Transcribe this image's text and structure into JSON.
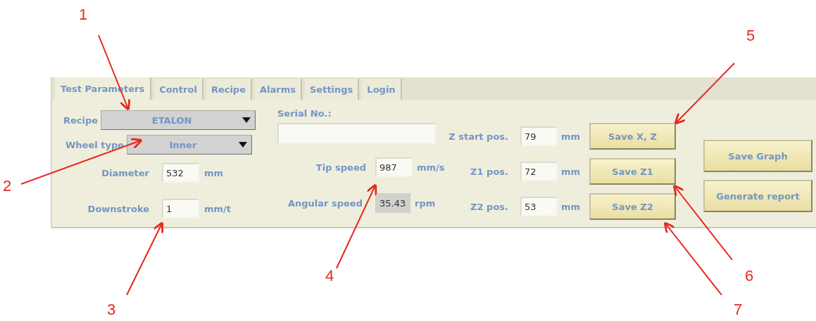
{
  "tabs": [
    {
      "label": "Test Parameters",
      "selected": true
    },
    {
      "label": "Control",
      "selected": false
    },
    {
      "label": "Recipe",
      "selected": false
    },
    {
      "label": "Alarms",
      "selected": false
    },
    {
      "label": "Settings",
      "selected": false
    },
    {
      "label": "Login",
      "selected": false
    }
  ],
  "recipe": {
    "label": "Recipe",
    "value": "ETALON"
  },
  "wheel_type": {
    "label": "Wheel type",
    "value": "Inner"
  },
  "left_fields": [
    {
      "label": "Diameter",
      "value": "532",
      "unit": "mm",
      "readonly": false
    },
    {
      "label": "Downstroke",
      "value": "1",
      "unit": "mm/t",
      "readonly": false
    }
  ],
  "serial": {
    "label": "Serial No.:"
  },
  "mid_fields": [
    {
      "label": "Tip speed",
      "value": "987",
      "unit": "mm/s",
      "readonly": false
    },
    {
      "label": "Angular speed",
      "value": "35.43",
      "unit": "rpm",
      "readonly": true
    }
  ],
  "z_rows": [
    {
      "label": "Z start pos.",
      "value": "79",
      "unit": "mm",
      "button": "Save X, Z"
    },
    {
      "label": "Z1 pos.",
      "value": "72",
      "unit": "mm",
      "button": "Save Z1"
    },
    {
      "label": "Z2 pos.",
      "value": "53",
      "unit": "mm",
      "button": "Save Z2"
    }
  ],
  "side_buttons": [
    "Save Graph",
    "Generate report"
  ],
  "callouts": [
    {
      "label": "1"
    },
    {
      "label": "2"
    },
    {
      "label": "3"
    },
    {
      "label": "4"
    },
    {
      "label": "5"
    },
    {
      "label": "6"
    },
    {
      "label": "7"
    }
  ]
}
